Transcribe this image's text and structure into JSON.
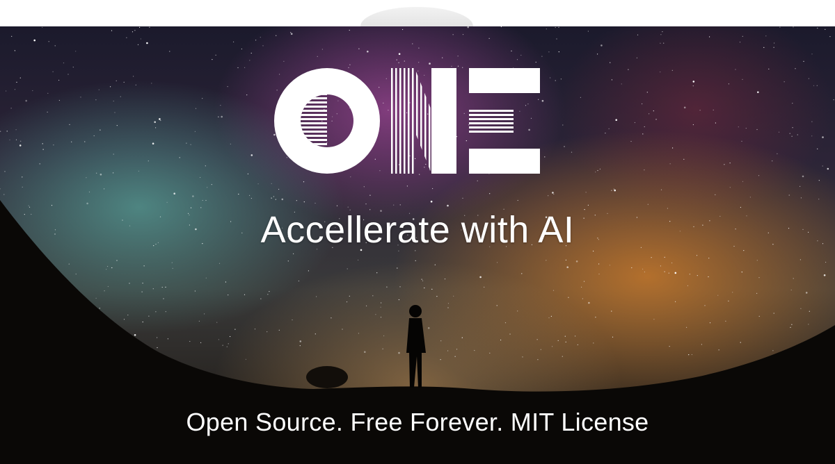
{
  "logo": {
    "text": "ONE",
    "color": "#ffffff"
  },
  "hero": {
    "tagline": "Accellerate with AI",
    "subline": "Open Source. Free Forever. MIT License"
  },
  "background": {
    "description_icon": "night-sky-milky-way-icon"
  },
  "colors": {
    "text": "#ffffff",
    "sky_purple": "#a0468f",
    "sky_teal": "#5aaaa0",
    "sky_orange": "#dc8228"
  }
}
